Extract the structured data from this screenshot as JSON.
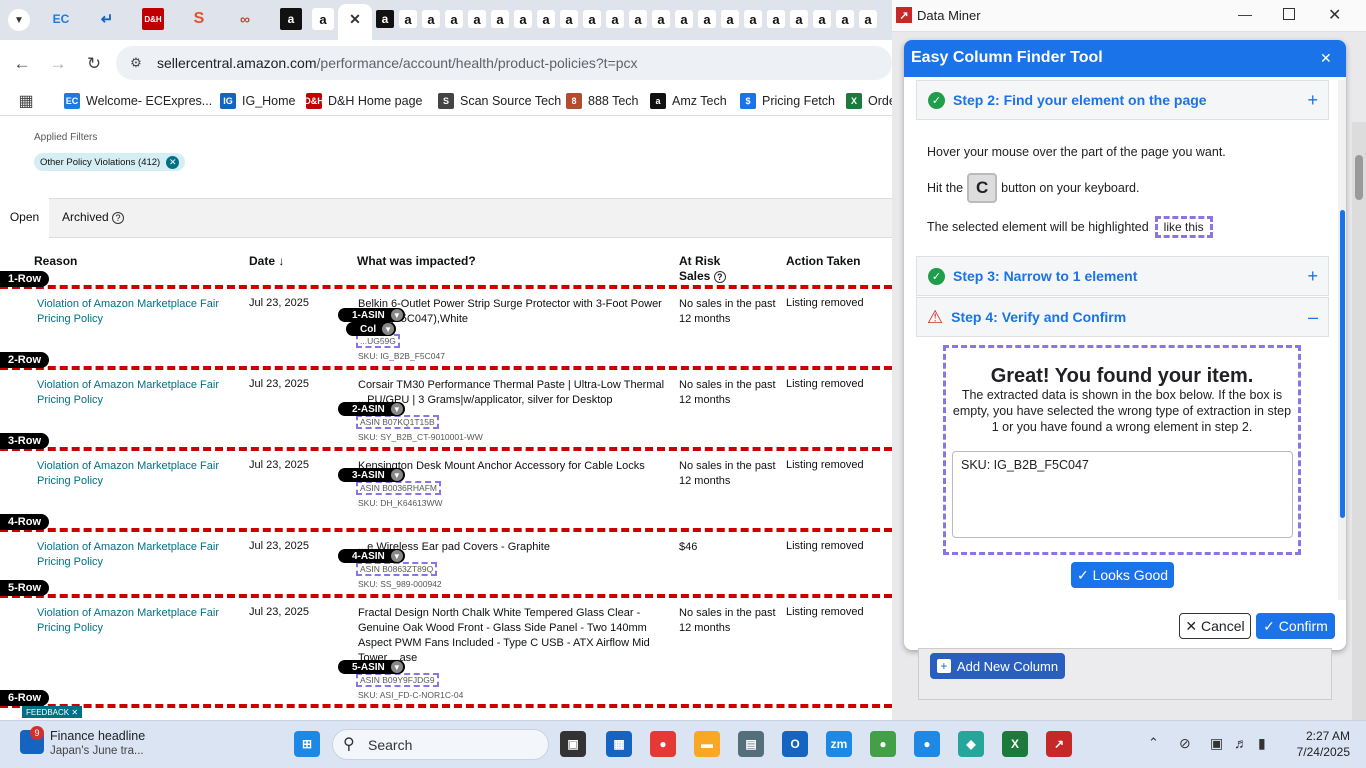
{
  "browser": {
    "url_host": "sellercentral.amazon.com",
    "url_path": "/performance/account/health/product-policies?t=pcx",
    "tab_icons": [
      "chevron-down-icon",
      "ecexpress-icon",
      "ig-icon",
      "dh-icon",
      "scan-icon",
      "tech888-icon",
      "amazon-icon",
      "amazon-icon",
      "close-icon"
    ],
    "bookmarks": [
      {
        "label": "Welcome- ECExpres...",
        "icon": "EC",
        "color": "#1f7ae0"
      },
      {
        "label": "IG_Home",
        "icon": "IG",
        "color": "#1565c0"
      },
      {
        "label": "D&H Home page",
        "icon": "D&H",
        "color": "#c00000"
      },
      {
        "label": "Scan Source Tech",
        "icon": "S",
        "color": "#444444"
      },
      {
        "label": "888 Tech",
        "icon": "8",
        "color": "#b34b2e"
      },
      {
        "label": "Amz Tech",
        "icon": "a",
        "color": "#111111"
      },
      {
        "label": "Pricing Fetch",
        "icon": "$",
        "color": "#1a73e8"
      },
      {
        "label": "Orde",
        "icon": "X",
        "color": "#1d7a3c"
      }
    ]
  },
  "page": {
    "applied_filters_label": "Applied Filters",
    "filter_chip": "Other Policy Violations (412)",
    "tab_open": "Open",
    "tab_archived": "Archived",
    "columns": {
      "reason": "Reason",
      "date": "Date",
      "what": "What was impacted?",
      "risk_line1": "At Risk",
      "risk_line2": "Sales",
      "action": "Action Taken"
    },
    "feedback": "FEEDBACK",
    "rows": [
      {
        "row_label": "1-Row",
        "reason": "Violation of Amazon Marketplace Fair Pricing Policy",
        "date": "Jul 23, 2025",
        "what": "Belkin 6-Outlet Power Strip Surge Protector with 3-Foot Power ...ales (F5C047),White",
        "asin_tag": "1-ASIN",
        "col_tag": "Col",
        "asin": "...UG59G",
        "sku": "SKU: IG_B2B_F5C047",
        "risk": "No sales in the past 12 months",
        "action": "Listing removed"
      },
      {
        "row_label": "2-Row",
        "reason": "Violation of Amazon Marketplace Fair Pricing Policy",
        "date": "Jul 23, 2025",
        "what": "Corsair TM30 Performance Thermal Paste | Ultra-Low Thermal ...PU/GPU | 3 Grams|w/applicator, silver for Desktop",
        "asin_tag": "2-ASIN",
        "asin": "ASIN B07KQ1T15B",
        "sku": "SKU: SY_B2B_CT-9010001-WW",
        "risk": "No sales in the past 12 months",
        "action": "Listing removed"
      },
      {
        "row_label": "3-Row",
        "reason": "Violation of Amazon Marketplace Fair Pricing Policy",
        "date": "Jul 23, 2025",
        "what": "Kensington Desk Mount Anchor Accessory for Cable Locks",
        "asin_tag": "3-ASIN",
        "asin": "ASIN B0036RHAFM",
        "sku": "SKU: DH_K64613WW",
        "risk": "No sales in the past 12 months",
        "action": "Listing removed"
      },
      {
        "row_label": "4-Row",
        "reason": "Violation of Amazon Marketplace Fair Pricing Policy",
        "date": "Jul 23, 2025",
        "what": "...e Wireless Ear pad Covers - Graphite",
        "asin_tag": "4-ASIN",
        "asin": "ASIN B0863ZT89Q",
        "sku": "SKU: SS_989-000942",
        "risk": "$46",
        "action": "Listing removed"
      },
      {
        "row_label": "5-Row",
        "reason": "Violation of Amazon Marketplace Fair Pricing Policy",
        "date": "Jul 23, 2025",
        "what": "Fractal Design North Chalk White Tempered Glass Clear - Genuine Oak Wood Front - Glass Side Panel - Two 140mm Aspect PWM Fans Included - Type C USB - ATX Airflow Mid Tower ...ase",
        "asin_tag": "5-ASIN",
        "asin": "ASIN B09Y9FJDG9",
        "sku": "SKU: ASI_FD-C-NOR1C-04",
        "risk": "No sales in the past 12 months",
        "action": "Listing removed"
      },
      {
        "row_label": "6-Row"
      }
    ]
  },
  "dataminer": {
    "window_title": "Data Miner",
    "panel_title": "Easy Column Finder Tool",
    "step2": "Step 2: Find your element on the page",
    "hover_text": "Hover your mouse over the part of the page you want.",
    "hit_prefix": "Hit the",
    "key": "C",
    "hit_suffix": "button on your keyboard.",
    "highlight_text": "The selected element will be highlighted",
    "like_this": "like this",
    "step3": "Step 3: Narrow to 1 element",
    "step4": "Step 4: Verify and Confirm",
    "found_title": "Great! You found your item.",
    "found_desc": "The extracted data is shown in the box below. If the box is empty, you have selected the wrong type of extraction in step 1 or you have found a wrong element in step 2.",
    "extracted_value": "SKU: IG_B2B_F5C047",
    "looks_good": "Looks Good",
    "cancel": "Cancel",
    "confirm": "Confirm",
    "add_column": "Add New Column"
  },
  "taskbar": {
    "news_badge": "9",
    "news_title": "Finance headline",
    "news_sub": "Japan's June tra...",
    "search": "Search",
    "time": "2:27 AM",
    "date": "7/24/2025"
  }
}
